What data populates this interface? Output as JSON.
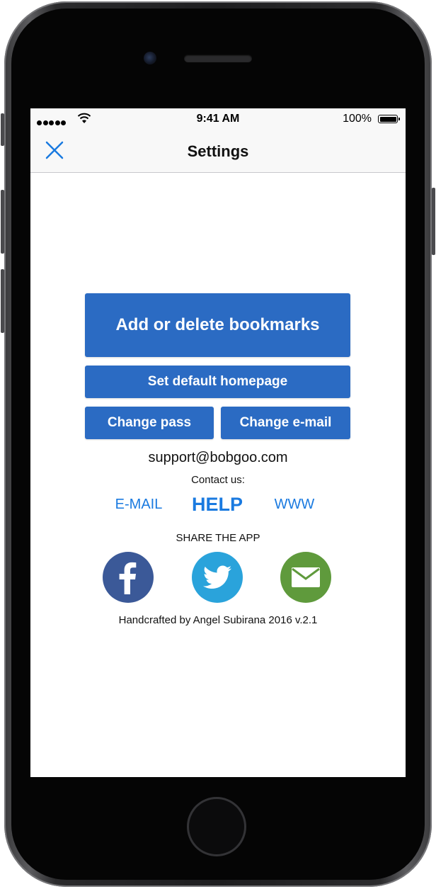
{
  "statusbar": {
    "time": "9:41 AM",
    "battery": "100%",
    "signal_icon": "signal-bars-icon",
    "wifi_icon": "wifi-icon",
    "battery_icon": "battery-icon"
  },
  "navbar": {
    "title": "Settings",
    "close_icon": "close-icon"
  },
  "actions": {
    "bookmarks_label": "Add or delete bookmarks",
    "homepage_label": "Set default homepage",
    "change_pass_label": "Change pass",
    "change_email_label": "Change e-mail"
  },
  "contact": {
    "support_email": "support@bobgoo.com",
    "heading": "Contact us:",
    "links": {
      "email": "E-MAIL",
      "help": "HELP",
      "www": "WWW"
    }
  },
  "share": {
    "heading": "SHARE THE APP",
    "icons": [
      "facebook-icon",
      "twitter-icon",
      "mail-icon"
    ]
  },
  "footer": {
    "credits": "Handcrafted by Angel Subirana 2016 v.2.1"
  },
  "colors": {
    "button_blue": "#2b6bc3",
    "link_blue": "#1a7ae0",
    "facebook": "#3b5998",
    "twitter": "#2aa3db",
    "mail": "#5f9a3c"
  }
}
